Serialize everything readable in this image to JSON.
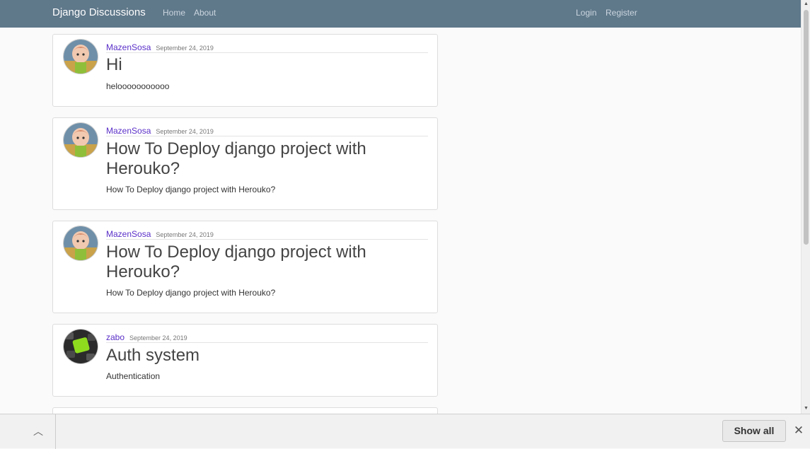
{
  "nav": {
    "brand": "Django Discussions",
    "links": [
      "Home",
      "About"
    ],
    "auth_links": [
      "Login",
      "Register"
    ]
  },
  "posts": [
    {
      "author": "MazenSosa",
      "date": "September 24, 2019",
      "title": "Hi",
      "content": "helooooooooooo",
      "avatar": "cartoon-avatar"
    },
    {
      "author": "MazenSosa",
      "date": "September 24, 2019",
      "title": "How To Deploy django project with Herouko?",
      "content": "How To Deploy django project with Herouko?",
      "avatar": "cartoon-avatar"
    },
    {
      "author": "MazenSosa",
      "date": "September 24, 2019",
      "title": "How To Deploy django project with Herouko?",
      "content": "How To Deploy django project with Herouko?",
      "avatar": "cartoon-avatar"
    },
    {
      "author": "zabo",
      "date": "September 24, 2019",
      "title": "Auth system",
      "content": "Authentication",
      "avatar": "keyboard-avatar"
    }
  ],
  "download_bar": {
    "show_all_label": "Show all",
    "close_icon": "close-icon",
    "expand_icon": "chevron-up-icon"
  },
  "colors": {
    "navbar": "#5f788a",
    "author_link": "#5a2fc8",
    "page_bg": "#fafafa"
  }
}
